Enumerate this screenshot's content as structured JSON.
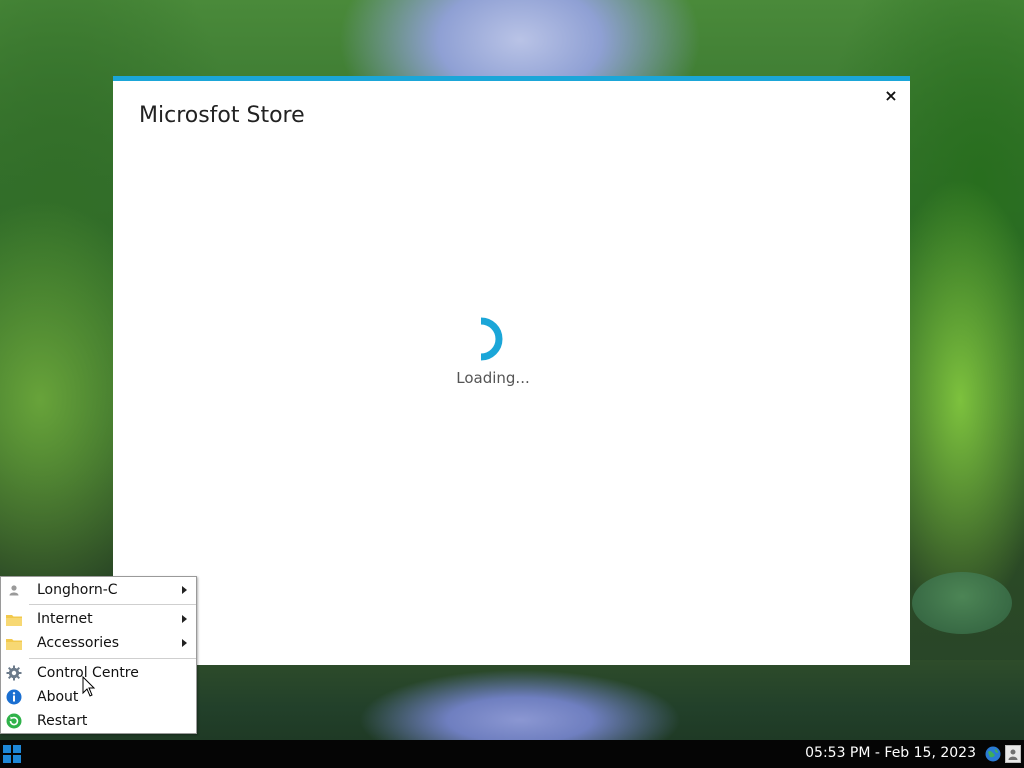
{
  "window": {
    "title": "Microsfot Store",
    "close_label": "×",
    "loading_text": "Loading...",
    "accent_color": "#1ba6d8"
  },
  "start_menu": {
    "items": [
      {
        "label": "Longhorn-C",
        "icon": "user-icon",
        "has_submenu": true
      },
      {
        "label": "Internet",
        "icon": "folder-icon",
        "has_submenu": true
      },
      {
        "label": "Accessories",
        "icon": "folder-icon",
        "has_submenu": true
      },
      {
        "label": "Control Centre",
        "icon": "gear-icon",
        "has_submenu": false
      },
      {
        "label": "About",
        "icon": "info-icon",
        "has_submenu": false
      },
      {
        "label": "Restart",
        "icon": "restart-icon",
        "has_submenu": false
      }
    ]
  },
  "taskbar": {
    "clock": "05:53 PM - Feb 15, 2023",
    "start_icon": "windows-logo-icon",
    "tray_icons": [
      "globe-icon",
      "user-icon"
    ]
  }
}
